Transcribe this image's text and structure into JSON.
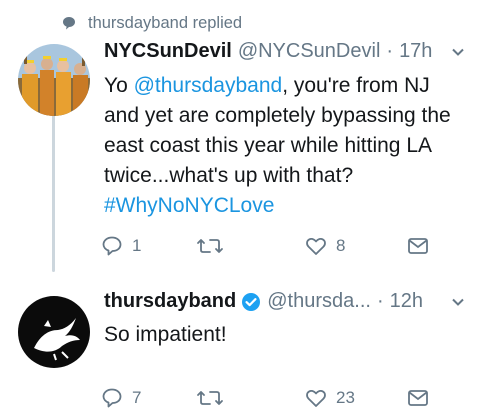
{
  "reply_context": {
    "icon": "speech-bubble-icon",
    "text": "thursdayband replied"
  },
  "parent_tweet": {
    "display_name": "NYCSunDevil",
    "handle": "@NYCSunDevil",
    "separator": "·",
    "time": "17h",
    "text_parts": {
      "lead": "Yo ",
      "mention": "@thursdayband",
      "body": ", you're from NJ and yet are completely bypassing the east coast this year while hitting LA twice...what's up with that?",
      "hashtag": "#WhyNoNYCLove"
    },
    "actions": {
      "reply_count": "1",
      "retweet_count": "",
      "like_count": "8"
    }
  },
  "reply_tweet": {
    "display_name": "thursdayband",
    "verified": true,
    "handle": "@thursda...",
    "separator": "·",
    "time": "12h",
    "text": "So impatient!",
    "actions": {
      "reply_count": "7",
      "retweet_count": "",
      "like_count": "23"
    }
  },
  "colors": {
    "link": "#1b95e0",
    "muted": "#657786",
    "verified": "#1da1f2",
    "thread": "#ccd6dd"
  }
}
